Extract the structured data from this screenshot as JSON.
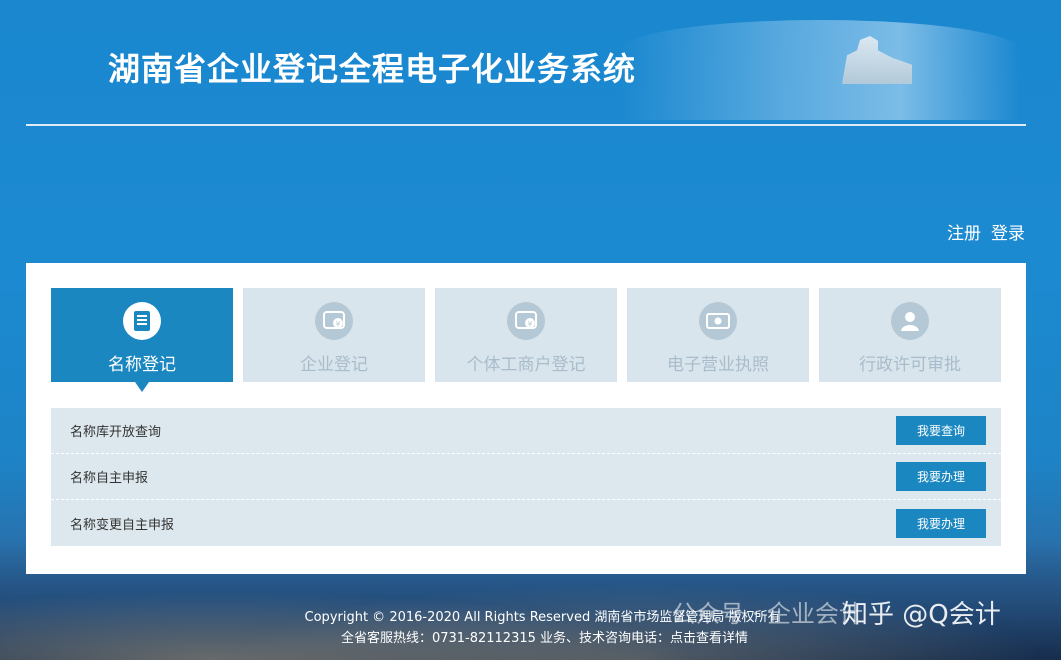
{
  "header": {
    "title": "湖南省企业登记全程电子化业务系统"
  },
  "auth": {
    "register": "注册",
    "login": "登录"
  },
  "tabs": [
    {
      "label": "名称登记",
      "icon": "document-icon",
      "active": true
    },
    {
      "label": "企业登记",
      "icon": "enterprise-icon",
      "active": false
    },
    {
      "label": "个体工商户登记",
      "icon": "individual-business-icon",
      "active": false
    },
    {
      "label": "电子营业执照",
      "icon": "license-icon",
      "active": false
    },
    {
      "label": "行政许可审批",
      "icon": "approval-icon",
      "active": false
    }
  ],
  "rows": [
    {
      "label": "名称库开放查询",
      "button": "我要查询"
    },
    {
      "label": "名称自主申报",
      "button": "我要办理"
    },
    {
      "label": "名称变更自主申报",
      "button": "我要办理"
    }
  ],
  "footer": {
    "copyright": "Copyright © 2016-2020 All Rights Reserved 湖南省市场监督管理局 版权所有",
    "hotline": "全省客服热线：0731-82112315   业务、技术咨询电话：点击查看详情"
  },
  "watermark": {
    "left": "公众号 · 企业会计",
    "right": "知乎 @Q会计"
  },
  "colors": {
    "primary": "#1b87c1",
    "tab_inactive": "#d9e5ec",
    "row_bg": "#dde8ee"
  }
}
